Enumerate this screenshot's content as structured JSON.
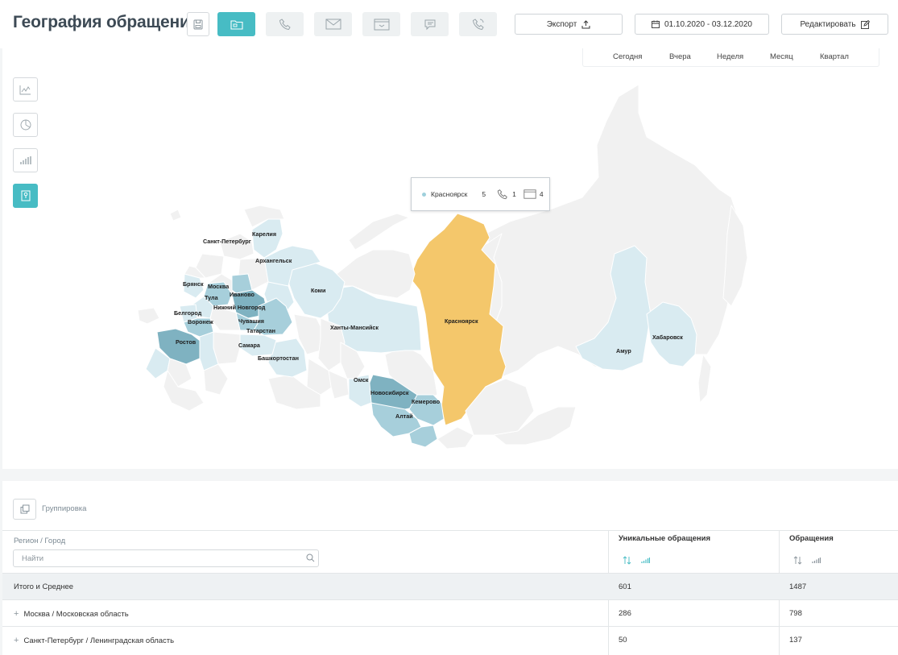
{
  "header": {
    "title": "География обращений",
    "export_label": "Экспорт",
    "date_range": "01.10.2020 - 03.12.2020",
    "edit_label": "Редактировать"
  },
  "periods": [
    "Сегодня",
    "Вчера",
    "Неделя",
    "Месяц",
    "Квартал"
  ],
  "map": {
    "labels": [
      "Карелия",
      "Санкт-Петербург",
      "Архангельск",
      "Брянск",
      "Москва",
      "Иваново",
      "Тула",
      "Нижний Новгород",
      "Белгород",
      "Воронеж",
      "Чувашия",
      "Татарстан",
      "Ростов",
      "Самара",
      "Башкортостан",
      "Коми",
      "Ханты-Мансийск",
      "Красноярск",
      "Омск",
      "Новосибирск",
      "Кемерово",
      "Алтай",
      "Амур",
      "Хабаровск"
    ],
    "colors": {
      "base": "#f1f1f1",
      "light": "#d9ebf1",
      "mid": "#a7cfdb",
      "dark": "#7fb2c1",
      "highlight": "#f4c76b",
      "border": "#ffffff"
    }
  },
  "tooltip": {
    "region": "Красноярск",
    "total": "5",
    "calls": "1",
    "messages": "4",
    "dot_color": "#9fd0dc"
  },
  "table": {
    "group_label": "Группировка",
    "col_region": "Регион / Город",
    "search_placeholder": "Найти",
    "col_unique": "Уникальные обращения",
    "col_total": "Обращения",
    "rows": [
      {
        "name": "Итого и Среднее",
        "unique": "601",
        "total": "1487"
      },
      {
        "name": "Москва / Московская область",
        "unique": "286",
        "total": "798"
      },
      {
        "name": "Санкт-Петербург / Ленинградская область",
        "unique": "50",
        "total": "137"
      }
    ]
  },
  "accent_color": "#47bcc4"
}
